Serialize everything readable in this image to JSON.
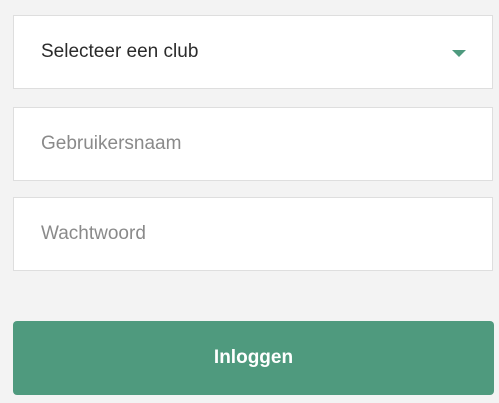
{
  "club_select": {
    "selected_value": "Selecteer een club",
    "caret_icon": "caret-down-icon",
    "caret_color": "#4e9a7e"
  },
  "username": {
    "value": "",
    "placeholder": "Gebruikersnaam"
  },
  "password": {
    "value": "",
    "placeholder": "Wachtwoord"
  },
  "login_button": {
    "label": "Inloggen",
    "color": "#4f9a7e"
  }
}
